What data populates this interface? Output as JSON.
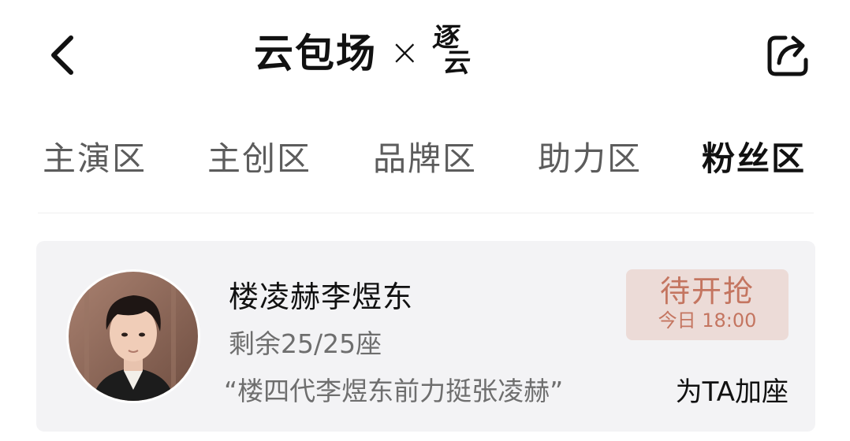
{
  "header": {
    "back_icon": "chevron-left-icon",
    "share_icon": "share-icon",
    "logo_left": "云包场",
    "logo_cross": "×",
    "logo_right_top": "逐",
    "logo_right_bottom": "云"
  },
  "tabs": [
    {
      "label": "主演区",
      "active": false
    },
    {
      "label": "主创区",
      "active": false
    },
    {
      "label": "品牌区",
      "active": false
    },
    {
      "label": "助力区",
      "active": false
    },
    {
      "label": "粉丝区",
      "active": true
    }
  ],
  "card": {
    "name": "楼凌赫李煜东",
    "seats": "剩余25/25座",
    "slogan": "“楼四代李煜东前力挺张凌赫”",
    "status_main": "待开抢",
    "status_sub": "今日 18:00",
    "add_seat": "为TA加座"
  },
  "colors": {
    "accent": "#c47560",
    "badge_bg": "#ecdbd7",
    "card_bg": "#f3f3f5"
  }
}
